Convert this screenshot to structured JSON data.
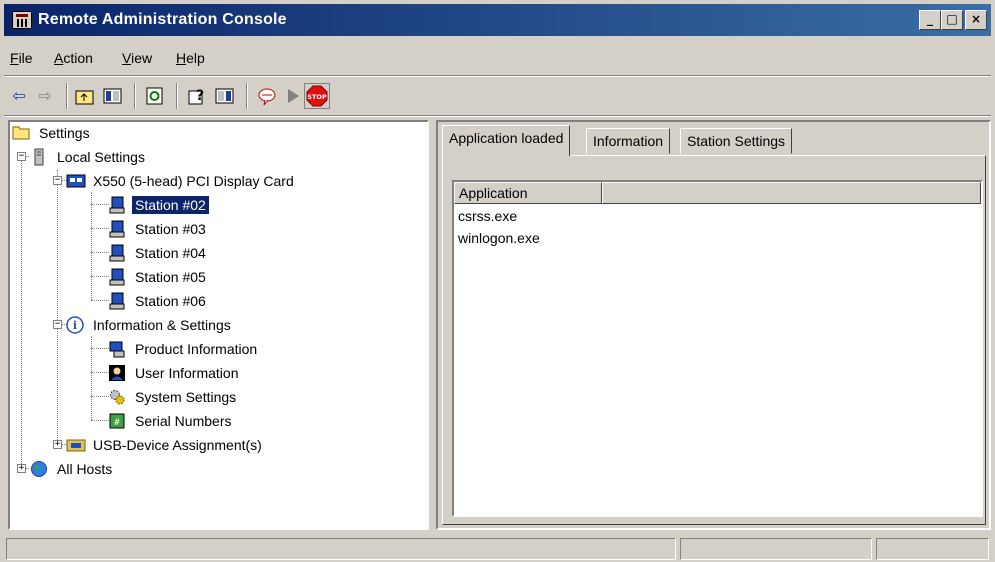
{
  "window": {
    "title": "Remote Administration Console",
    "buttons": {
      "minimize": "_",
      "maximize": "□",
      "close": "×"
    }
  },
  "menu": {
    "file": "File",
    "action": "Action",
    "view": "View",
    "help": "Help"
  },
  "toolbar": {
    "icons": [
      "back-icon",
      "forward-icon",
      "up-folder-icon",
      "show-hide-tree-icon",
      "refresh-icon",
      "help-icon",
      "view-icon",
      "message-icon",
      "play-icon",
      "stop-icon"
    ],
    "stop_label": "STOP"
  },
  "tree": {
    "root": "Settings",
    "local_settings": "Local Settings",
    "card": "X550 (5-head)  PCI Display Card",
    "stations": [
      "Station #02",
      "Station #03",
      "Station #04",
      "Station #05",
      "Station #06"
    ],
    "selected": "Station #02",
    "info_settings": "Information & Settings",
    "info_items": [
      "Product Information",
      "User Information",
      "System Settings",
      "Serial Numbers"
    ],
    "usb": "USB-Device Assignment(s)",
    "all_hosts": "All Hosts"
  },
  "tabs": [
    "Application loaded",
    "Information",
    "Station Settings"
  ],
  "active_tab": "Application loaded",
  "list": {
    "columns": [
      "Application",
      ""
    ],
    "rows": [
      "csrss.exe",
      "winlogon.exe"
    ]
  },
  "colors": {
    "title_start": "#0a246a",
    "title_end": "#3a6ea5",
    "selection": "#0a246a",
    "stop": "#e01010"
  }
}
